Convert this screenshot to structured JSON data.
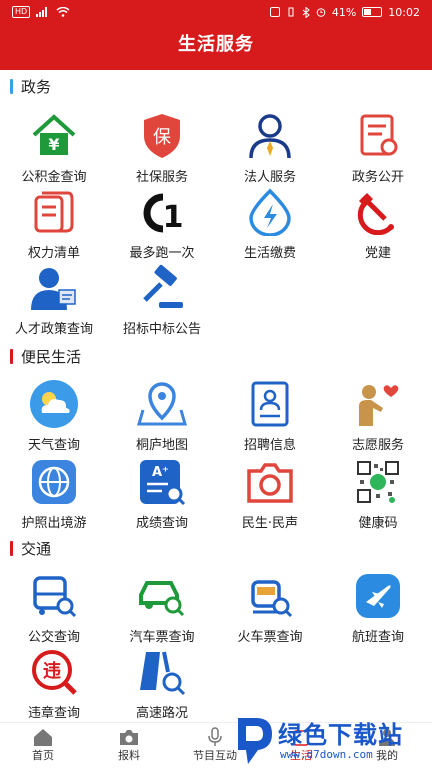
{
  "status_bar": {
    "signal_box": "HD",
    "battery_percent": "41%",
    "time": "10:02",
    "battery_level": 0.41
  },
  "header": {
    "title": "生活服务"
  },
  "sections": [
    {
      "title": "政务",
      "accent": "#3aa0e6",
      "items": [
        {
          "label": "公积金查询",
          "icon": "house-yuan-icon"
        },
        {
          "label": "社保服务",
          "icon": "shield-bao-icon"
        },
        {
          "label": "法人服务",
          "icon": "person-tie-icon"
        },
        {
          "label": "政务公开",
          "icon": "document-check-icon"
        },
        {
          "label": "权力清单",
          "icon": "list-scroll-icon"
        },
        {
          "label": "最多跑一次",
          "icon": "run-once-icon"
        },
        {
          "label": "生活缴费",
          "icon": "lightning-drop-icon"
        },
        {
          "label": "党建",
          "icon": "hammer-sickle-icon"
        },
        {
          "label": "人才政策查询",
          "icon": "talent-person-icon"
        },
        {
          "label": "招标中标公告",
          "icon": "gavel-icon"
        }
      ]
    },
    {
      "title": "便民生活",
      "accent": "#d71a1b",
      "items": [
        {
          "label": "天气查询",
          "icon": "weather-cloud-icon"
        },
        {
          "label": "桐庐地图",
          "icon": "map-pin-icon"
        },
        {
          "label": "招聘信息",
          "icon": "recruit-resume-icon"
        },
        {
          "label": "志愿服务",
          "icon": "volunteer-heart-icon"
        },
        {
          "label": "护照出境游",
          "icon": "globe-icon"
        },
        {
          "label": "成绩查询",
          "icon": "score-search-icon"
        },
        {
          "label": "民生·民声",
          "icon": "camera-icon"
        },
        {
          "label": "健康码",
          "icon": "qr-code-icon"
        }
      ]
    },
    {
      "title": "交通",
      "accent": "#d71a1b",
      "items": [
        {
          "label": "公交查询",
          "icon": "bus-search-icon"
        },
        {
          "label": "汽车票查询",
          "icon": "car-search-icon"
        },
        {
          "label": "火车票查询",
          "icon": "train-search-icon"
        },
        {
          "label": "航班查询",
          "icon": "airplane-icon"
        },
        {
          "label": "违章查询",
          "icon": "violation-search-icon"
        },
        {
          "label": "高速路况",
          "icon": "road-search-icon"
        }
      ]
    }
  ],
  "tabbar": [
    {
      "label": "首页",
      "icon": "home-icon"
    },
    {
      "label": "报料",
      "icon": "camera-icon"
    },
    {
      "label": "节目互动",
      "icon": "microphone-icon"
    },
    {
      "label": "生活",
      "icon": "life-icon",
      "active": true
    },
    {
      "label": "我的",
      "icon": "user-icon"
    }
  ],
  "watermark": {
    "brand": "绿色下载站",
    "url": "www.d7down.com"
  },
  "colors": {
    "brand_red": "#d71a1b",
    "icon_blue": "#1f63c6",
    "icon_red": "#e0463c",
    "icon_green": "#1e9a3a"
  }
}
